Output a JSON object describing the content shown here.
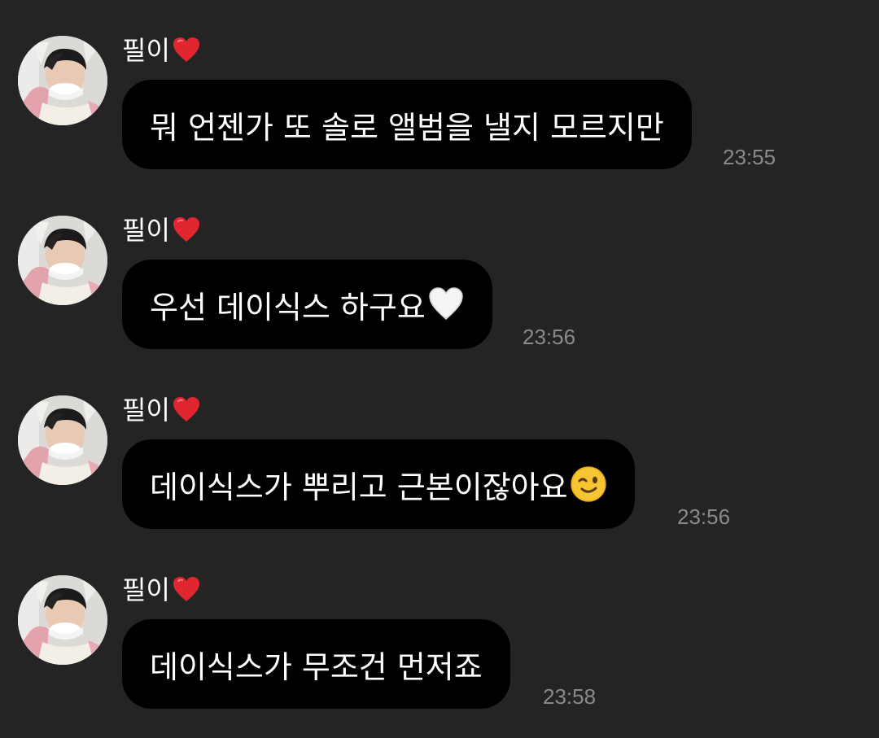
{
  "colors": {
    "background": "#242424",
    "bubble": "#000000",
    "text": "#ffffff",
    "timestamp": "#8a8a8a",
    "heart": "#e1262f"
  },
  "messages": [
    {
      "sender": "필이",
      "sender_icon": "red-heart-icon",
      "text": "뭐 언젠가 또 솔로 앨범을 낼지 모르지만",
      "emoji": "",
      "time": "23:55"
    },
    {
      "sender": "필이",
      "sender_icon": "red-heart-icon",
      "text": "우선 데이식스 하구요",
      "emoji": "white-heart-icon",
      "time": "23:56"
    },
    {
      "sender": "필이",
      "sender_icon": "red-heart-icon",
      "text": "데이식스가 뿌리고 근본이잖아요",
      "emoji": "winking-face-icon",
      "time": "23:56"
    },
    {
      "sender": "필이",
      "sender_icon": "red-heart-icon",
      "text": "데이식스가 무조건 먼저죠",
      "emoji": "",
      "time": "23:58"
    }
  ]
}
